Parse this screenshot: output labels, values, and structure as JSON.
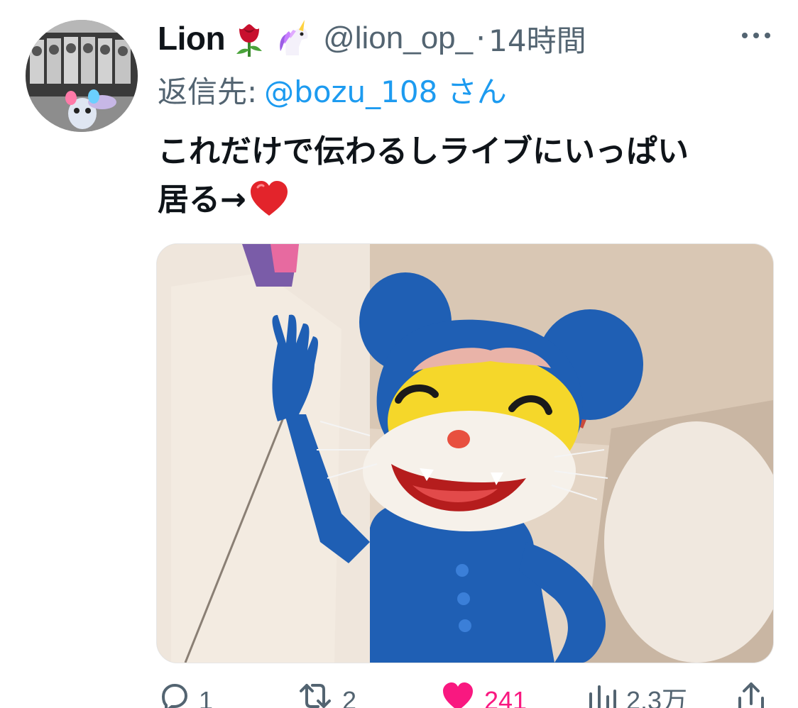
{
  "tweet": {
    "display_name": "Lion",
    "name_emojis": [
      "rose-emoji",
      "unicorn-emoji"
    ],
    "handle": "@lion_op_",
    "separator": "·",
    "time": "14時間",
    "reply_prefix": "返信先:",
    "reply_target": "@bozu_108 さん",
    "text_line_1": "これだけで伝わるしライブにいっぱい",
    "text_line_2": "居る→",
    "text_emoji": "red-heart-emoji"
  },
  "actions": {
    "reply_count": "1",
    "retweet_count": "2",
    "like_count": "241",
    "views_count": "2.3万"
  },
  "colors": {
    "text": "#0f1419",
    "secondary": "#536471",
    "link": "#1d9bf0",
    "like": "#f91880"
  }
}
